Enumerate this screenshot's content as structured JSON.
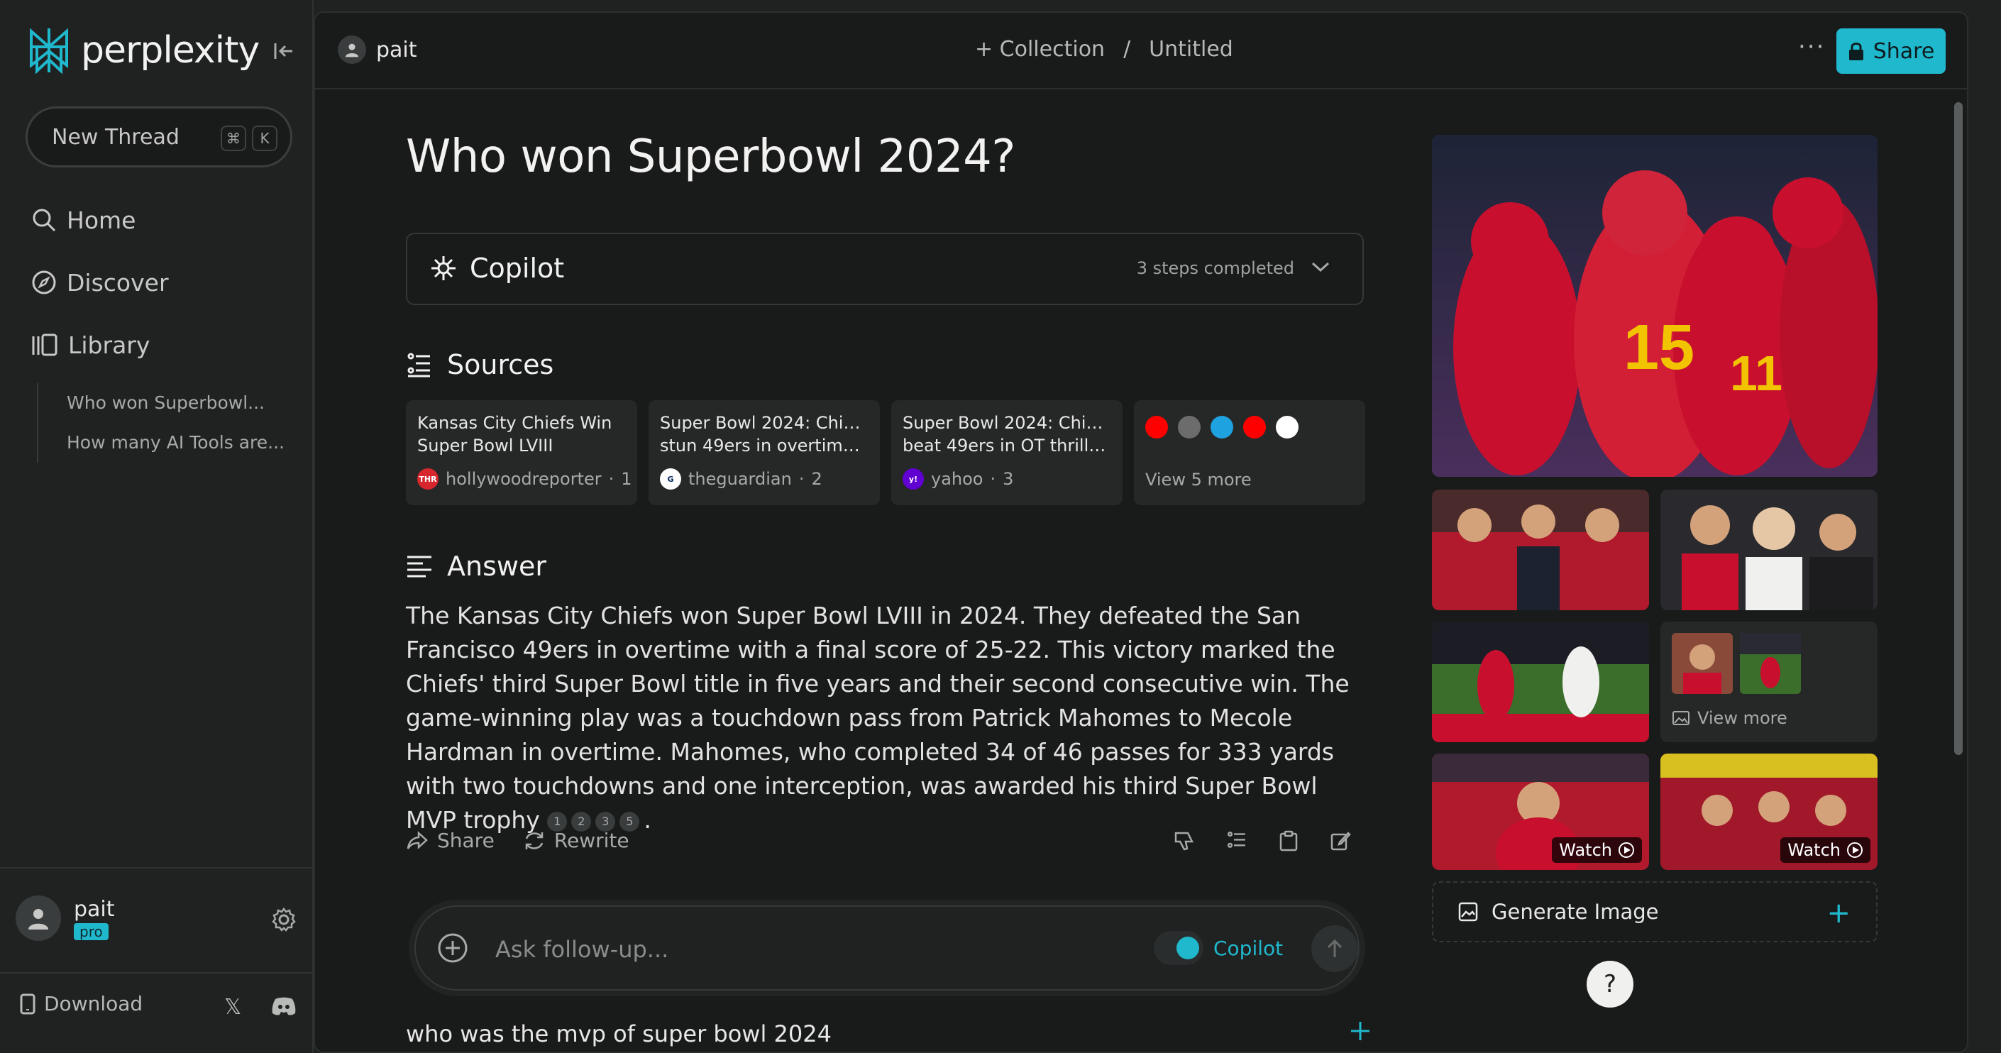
{
  "sidebar": {
    "logo_text": "perplexity",
    "new_thread": "New Thread",
    "shortcut": [
      "⌘",
      "K"
    ],
    "nav": [
      {
        "label": "Home",
        "icon": "search-icon"
      },
      {
        "label": "Discover",
        "icon": "compass-icon"
      },
      {
        "label": "Library",
        "icon": "library-icon"
      }
    ],
    "library_threads": [
      "Who won Superbowl...",
      "How many AI Tools are..."
    ],
    "user": {
      "name": "pait",
      "badge": "pro"
    },
    "download": "Download"
  },
  "topbar": {
    "user": "pait",
    "collection": "+ Collection",
    "separator": "/",
    "title": "Untitled",
    "more": "···",
    "share": "Share"
  },
  "thread": {
    "question": "Who won Superbowl 2024?",
    "copilot": {
      "label": "Copilot",
      "status": "3 steps completed"
    },
    "sources_heading": "Sources",
    "sources": [
      {
        "title1": "Kansas City Chiefs Win",
        "title2": "Super Bowl LVIII",
        "site": "hollywoodreporter",
        "index": "1",
        "fav_color": "#d7262d",
        "fav_text": "THR"
      },
      {
        "title1": "Super Bowl 2024: Chiefs",
        "title2": "stun 49ers in overtime...",
        "site": "theguardian",
        "index": "2",
        "fav_color": "#052962",
        "fav_text": "G"
      },
      {
        "title1": "Super Bowl 2024: Chiefs",
        "title2": "beat 49ers in OT thriller...",
        "site": "yahoo",
        "index": "3",
        "fav_color": "#6001d2",
        "fav_text": "y!"
      }
    ],
    "more_sources": {
      "label": "View 5 more",
      "favicons": [
        "#ff0000",
        "#6c6c6c",
        "#1fa2e0",
        "#ff0000",
        "#ffffff"
      ]
    },
    "answer_heading": "Answer",
    "answer_text": "The Kansas City Chiefs won Super Bowl LVIII in 2024. They defeated the San Francisco 49ers in overtime with a final score of 25-22. This victory marked the Chiefs' third Super Bowl title in five years and their second consecutive win. The game-winning play was a touchdown pass from Patrick Mahomes to Mecole Hardman in overtime. Mahomes, who completed 34 of 46 passes for 333 yards with two touchdowns and one interception, was awarded his third Super Bowl MVP trophy",
    "citations": [
      "1",
      "2",
      "3",
      "5"
    ],
    "answer_end": ".",
    "actions": {
      "share": "Share",
      "rewrite": "Rewrite"
    },
    "followup_placeholder": "Ask follow-up...",
    "followup_copilot": "Copilot",
    "related": "who was the mvp of super bowl 2024"
  },
  "media": {
    "view_more": "View more",
    "watch": "Watch",
    "generate_image": "Generate Image"
  },
  "colors": {
    "accent": "#20b8cd",
    "bg": "#191a1a",
    "sidebar": "#202222"
  },
  "help": "?"
}
